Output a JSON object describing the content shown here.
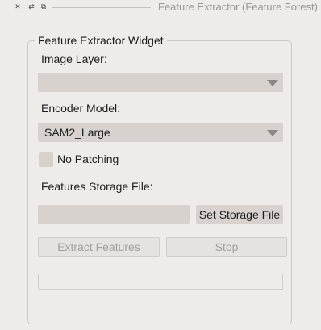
{
  "window": {
    "title": "Feature Extractor (Feature Forest)",
    "close_glyph": "✕",
    "float_glyph": "⇄",
    "detach_glyph": "⧉"
  },
  "group": {
    "title": "Feature Extractor Widget"
  },
  "image_layer": {
    "label": "Image Layer:",
    "selected": ""
  },
  "encoder_model": {
    "label": "Encoder Model:",
    "selected": "SAM2_Large"
  },
  "no_patching": {
    "label": "No Patching",
    "checked": false
  },
  "storage": {
    "label": "Features Storage File:",
    "value": "",
    "button_label": "Set Storage File"
  },
  "actions": {
    "extract_label": "Extract Features",
    "stop_label": "Stop"
  },
  "progress": {
    "value": 0
  },
  "colors": {
    "background": "#efebe8",
    "control": "#d7d2ce",
    "disabled_text": "#a39f9c"
  }
}
